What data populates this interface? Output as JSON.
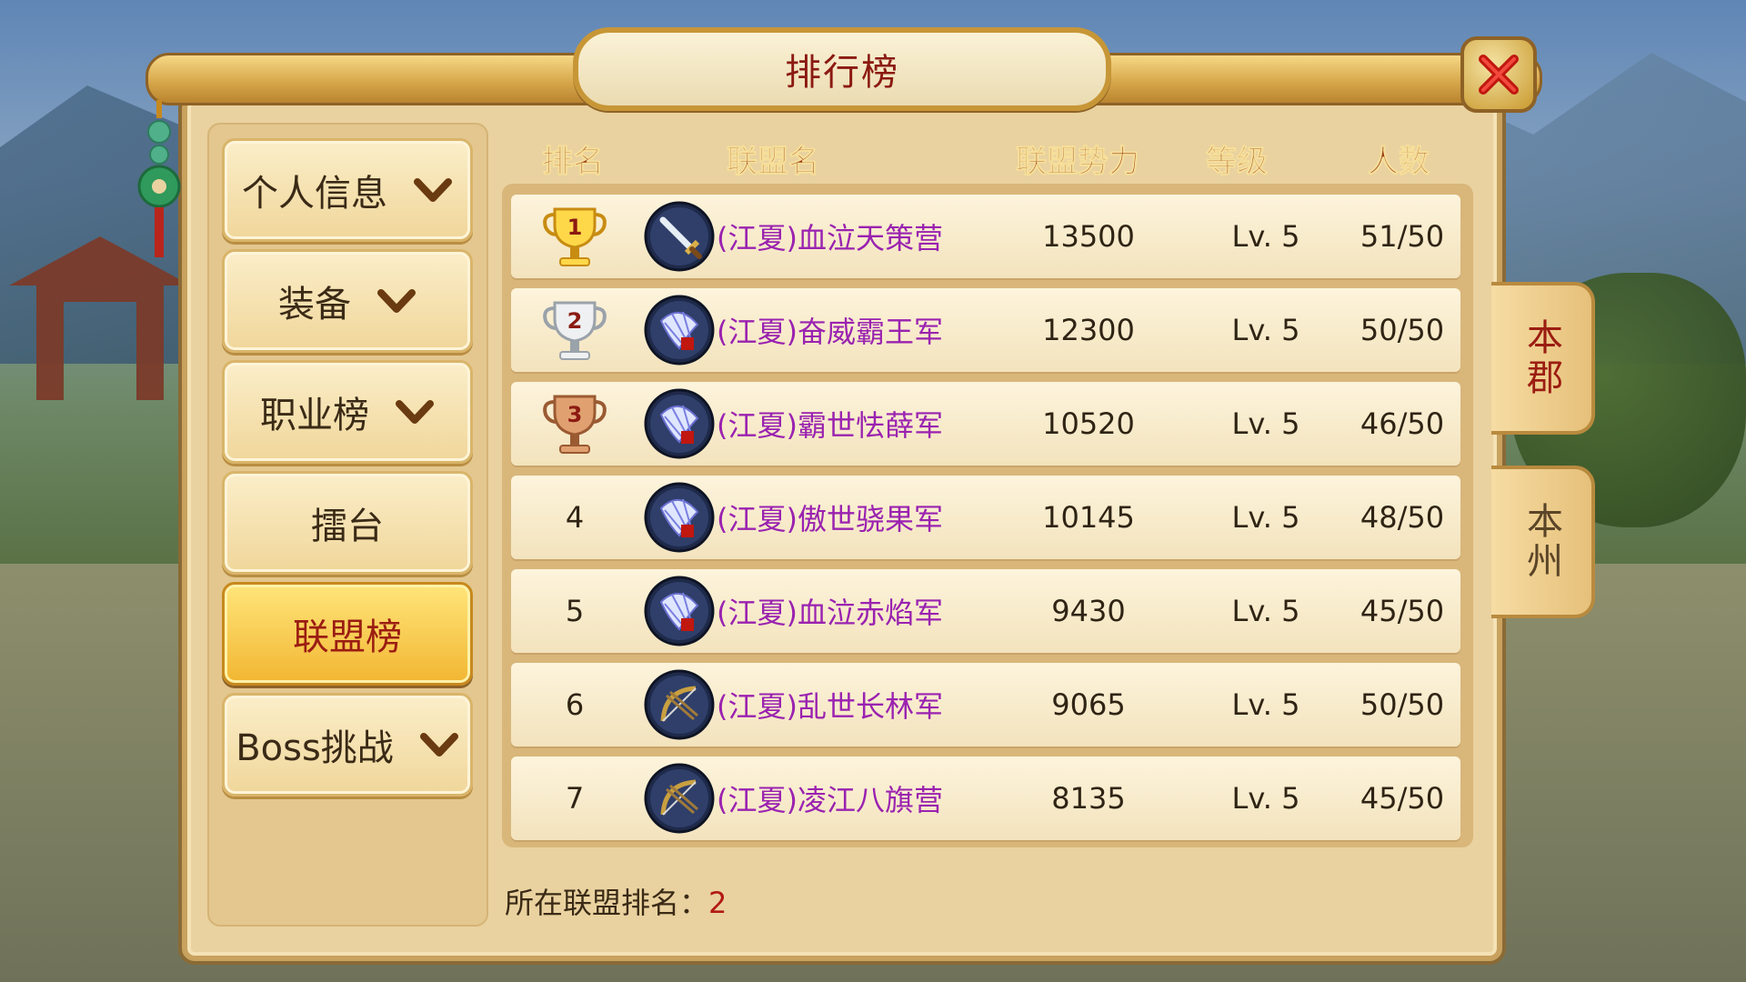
{
  "window": {
    "title": "排行榜"
  },
  "menu": [
    {
      "label": "个人信息",
      "chevron": true,
      "active": false
    },
    {
      "label": "装备",
      "chevron": true,
      "active": false
    },
    {
      "label": "职业榜",
      "chevron": true,
      "active": false
    },
    {
      "label": "擂台",
      "chevron": false,
      "active": false
    },
    {
      "label": "联盟榜",
      "chevron": false,
      "active": true
    },
    {
      "label": "Boss挑战",
      "chevron": true,
      "active": false
    }
  ],
  "table": {
    "headers": {
      "rank": "排名",
      "name": "联盟名",
      "power": "联盟势力",
      "level": "等级",
      "count": "人数"
    },
    "rows": [
      {
        "rank": "1",
        "trophy": "gold-trophy-icon",
        "emblem": "sword-emblem-icon",
        "name": "(江夏)血泣天策营",
        "power": "13500",
        "level": "Lv. 5",
        "count": "51/50"
      },
      {
        "rank": "2",
        "trophy": "silver-trophy-icon",
        "emblem": "feather-emblem-icon",
        "name": "(江夏)奋威霸王军",
        "power": "12300",
        "level": "Lv. 5",
        "count": "50/50"
      },
      {
        "rank": "3",
        "trophy": "bronze-trophy-icon",
        "emblem": "feather-emblem-icon",
        "name": "(江夏)霸世怯薛军",
        "power": "10520",
        "level": "Lv. 5",
        "count": "46/50"
      },
      {
        "rank": "4",
        "trophy": "",
        "emblem": "feather-emblem-icon",
        "name": "(江夏)傲世骁果军",
        "power": "10145",
        "level": "Lv. 5",
        "count": "48/50"
      },
      {
        "rank": "5",
        "trophy": "",
        "emblem": "feather-emblem-icon",
        "name": "(江夏)血泣赤焰军",
        "power": "9430",
        "level": "Lv. 5",
        "count": "45/50"
      },
      {
        "rank": "6",
        "trophy": "",
        "emblem": "bow-emblem-icon",
        "name": "(江夏)乱世长林军",
        "power": "9065",
        "level": "Lv. 5",
        "count": "50/50"
      },
      {
        "rank": "7",
        "trophy": "",
        "emblem": "bow-emblem-icon",
        "name": "(江夏)凌江八旗营",
        "power": "8135",
        "level": "Lv. 5",
        "count": "45/50"
      }
    ]
  },
  "footer": {
    "label": "所在联盟排名：",
    "value": "2"
  },
  "side_tabs": [
    {
      "label": "本郡",
      "active": true
    },
    {
      "label": "本州",
      "active": false
    }
  ],
  "colors": {
    "title": "#8b1a12",
    "alliance_name": "#9a22b0",
    "header": "#9b3a12",
    "accent_gold": "#f2b632"
  }
}
